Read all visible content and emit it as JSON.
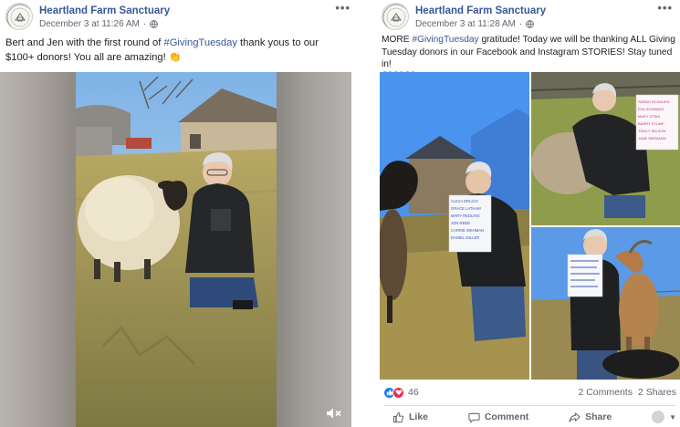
{
  "posts": [
    {
      "page_name": "Heartland Farm Sanctuary",
      "timestamp": "December 3 at 11:26 AM",
      "text_before": "Bert and Jen with the first round of ",
      "hashtag": "#GivingTuesday",
      "text_after": " thank yous to our $100+ donors! You all are amazing! 👏",
      "more_label": "•••"
    },
    {
      "page_name": "Heartland Farm Sanctuary",
      "timestamp": "December 3 at 11:28 AM",
      "text_before": "MORE ",
      "hashtag": "#GivingTuesday",
      "text_after": " gratitude! Today we will be thanking ALL Giving Tuesday donors in our Facebook and Instagram STORIES! Stay tuned in!",
      "hearts": "❤️❤️❤️",
      "more_label": "•••",
      "reaction_count": "46",
      "comments": "2 Comments",
      "shares": "2 Shares",
      "actions": {
        "like": "Like",
        "comment": "Comment",
        "share": "Share"
      }
    }
  ],
  "signs": {
    "tile_a": [
      "ALICIA ERLICH",
      "GRACE LATHAM",
      "MARY REDLING",
      "JON REED",
      "CARRIE WEHMAN",
      "DANIEL MILLER"
    ],
    "tile_b": [
      "SARAH SCHAUEN",
      "EVA SCHWARZ",
      "MARY STEIN",
      "BARRY STUMP",
      "TRACY WILSON",
      "JANE WIEMANN"
    ]
  },
  "icons": {
    "avatar": "sanctuary-logo-icon",
    "globe": "globe-icon",
    "mute": "muted-speaker-icon",
    "like": "thumbs-up-icon",
    "comment": "comment-bubble-icon",
    "share": "share-arrow-icon"
  },
  "colors": {
    "link": "#385898",
    "like_blue": "#2078f4",
    "love_red": "#f0284a",
    "meta_gray": "#606770"
  }
}
